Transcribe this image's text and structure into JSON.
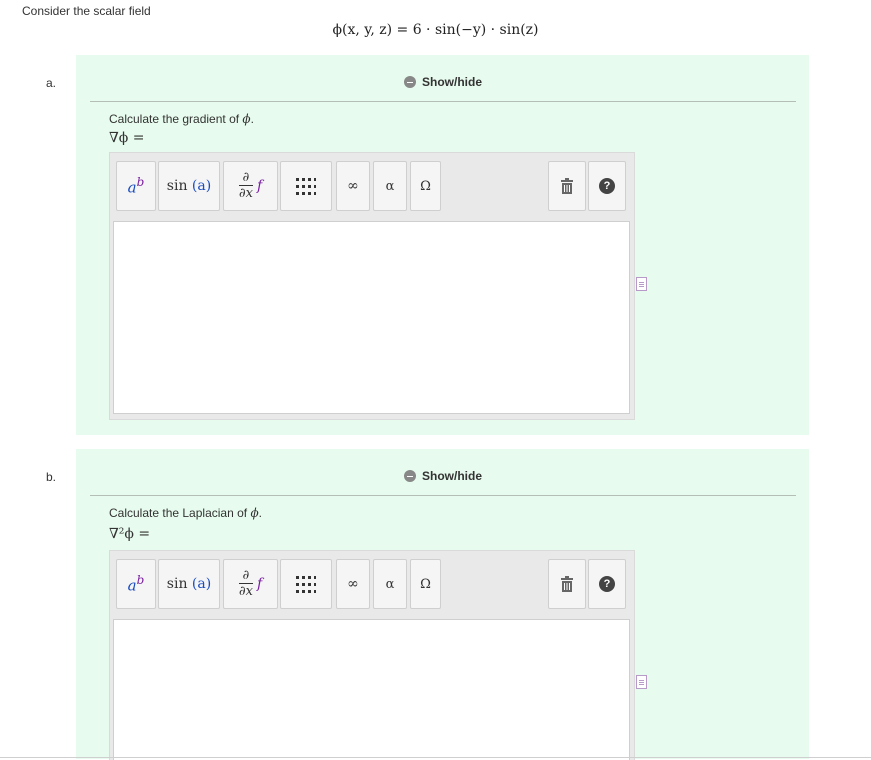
{
  "intro_text": "Consider the scalar field",
  "formula": "ϕ(x, y, z) = 6 · sin(−y) · sin(z)",
  "show_hide_label": "Show/hide",
  "toolbar": {
    "superscript_icon": "superscript-icon",
    "function_label": "sin",
    "function_arg": "(a)",
    "partial_top": "∂",
    "partial_bottom": "∂x",
    "partial_f": "f",
    "matrix_icon": "matrix-icon",
    "infinity": "∞",
    "alpha": "α",
    "omega": "Ω",
    "trash_icon": "trash-icon",
    "help": "?"
  },
  "parts": [
    {
      "letter": "a.",
      "question_prefix": "Calculate the gradient of ",
      "question_symbol": "ϕ",
      "question_suffix": ".",
      "lhs": "∇ϕ ="
    },
    {
      "letter": "b.",
      "question_prefix": "Calculate the Laplacian of ",
      "question_symbol": "ϕ",
      "question_suffix": ".",
      "lhs": "∇²ϕ ="
    }
  ]
}
